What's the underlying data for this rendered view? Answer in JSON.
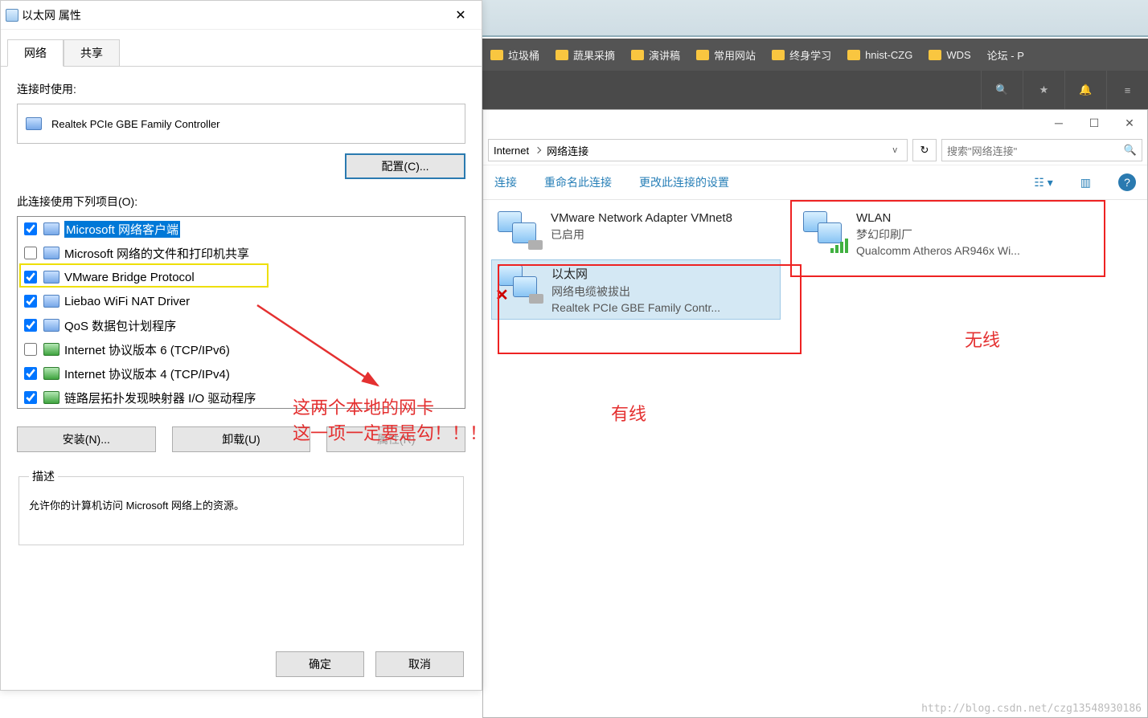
{
  "dialog": {
    "title": "以太网 属性",
    "close_icon": "close-icon",
    "tabs": [
      "网络",
      "共享"
    ],
    "connect_using_label": "连接时使用:",
    "adapter_name": "Realtek PCIe GBE Family Controller",
    "configure_btn": "配置(C)...",
    "items_label": "此连接使用下列项目(O):",
    "items": [
      {
        "checked": true,
        "text": "Microsoft 网络客户端",
        "selected": true
      },
      {
        "checked": false,
        "text": "Microsoft 网络的文件和打印机共享"
      },
      {
        "checked": true,
        "text": "VMware Bridge Protocol",
        "highlight": true
      },
      {
        "checked": true,
        "text": "Liebao WiFi NAT Driver"
      },
      {
        "checked": true,
        "text": "QoS 数据包计划程序"
      },
      {
        "checked": false,
        "text": "Internet 协议版本 6 (TCP/IPv6)",
        "green": true
      },
      {
        "checked": true,
        "text": "Internet 协议版本 4 (TCP/IPv4)",
        "green": true
      },
      {
        "checked": true,
        "text": "链路层拓扑发现映射器 I/O 驱动程序",
        "green": true
      }
    ],
    "install_btn": "安装(N)...",
    "uninstall_btn": "卸载(U)",
    "properties_btn": "属性(R)",
    "desc_legend": "描述",
    "desc_text": "允许你的计算机访问 Microsoft 网络上的资源。",
    "ok_btn": "确定",
    "cancel_btn": "取消"
  },
  "bookmarks": [
    "垃圾桶",
    "蔬果采摘",
    "演讲稿",
    "常用网站",
    "终身学习",
    "hnist-CZG",
    "WDS",
    "论坛 - P"
  ],
  "explorer": {
    "crumb1": "Internet",
    "crumb2": "网络连接",
    "search_placeholder": "搜索\"网络连接\"",
    "cmd_connect": "连接",
    "cmd_rename": "重命名此连接",
    "cmd_change": "更改此连接的设置",
    "connections": [
      {
        "title": "VMware Network Adapter VMnet8",
        "l2": "已启用",
        "l3": ""
      },
      {
        "title": "WLAN",
        "l2": "梦幻印刷厂",
        "l3": "Qualcomm Atheros AR946x Wi...",
        "wireless": true
      },
      {
        "title": "以太网",
        "l2": "网络电缆被拔出",
        "l3": "Realtek PCIe GBE Family Contr...",
        "selected": true,
        "disconnected": true
      }
    ]
  },
  "annotations": {
    "main1": "这两个本地的网卡",
    "main2": "这一项一定要是勾！！！",
    "youxian": "有线",
    "wuxian": "无线"
  },
  "watermark": "http://blog.csdn.net/czg13548930186"
}
